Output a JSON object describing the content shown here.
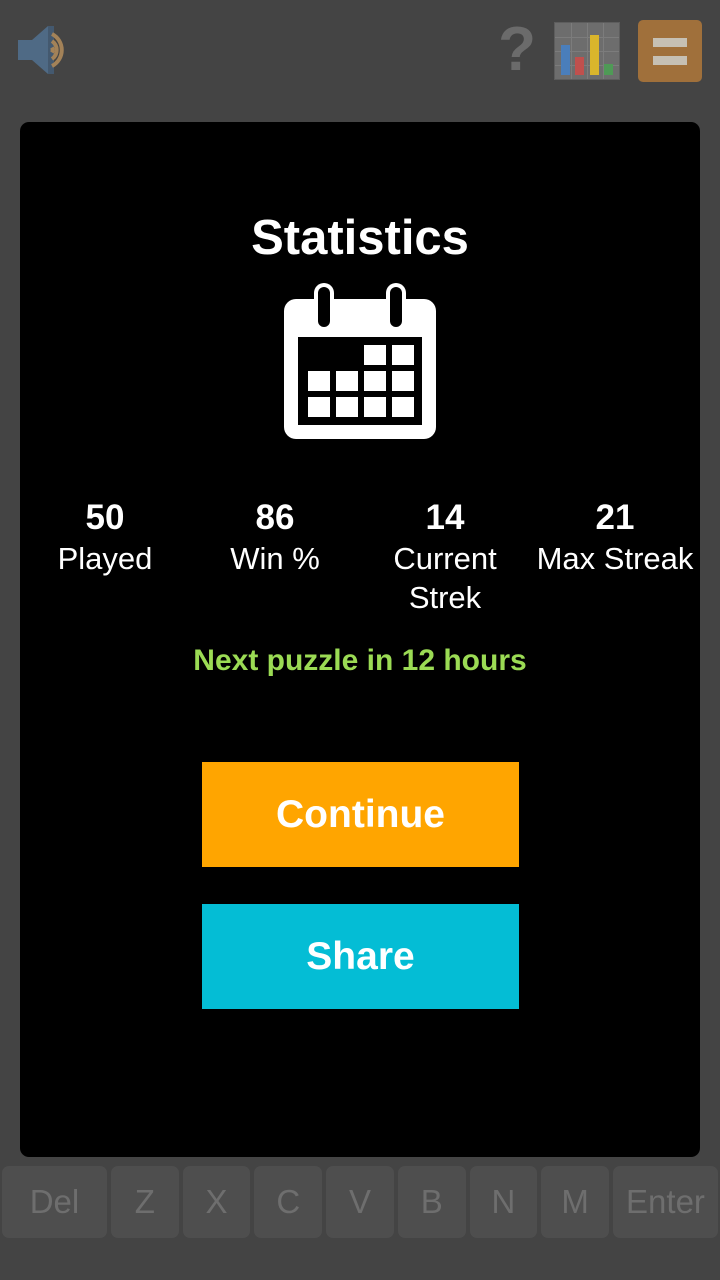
{
  "colors": {
    "app_background": "#444444",
    "modal_background": "#000000",
    "accent_orange": "#ffa500",
    "accent_cyan": "#04bdd5",
    "countdown_green": "#9bdb54",
    "menu_icon_orange": "#a0703b",
    "key_background": "#4e4e4e",
    "key_text": "#6e6e6e"
  },
  "top_bar": {
    "sound_icon": "sound-on-icon",
    "help_icon": "help-question-mark-icon",
    "help_label": "?",
    "chart_icon": "bar-chart-icon",
    "menu_icon": "menu-hamburger-icon"
  },
  "modal": {
    "title": "Statistics",
    "calendar_icon": "calendar-icon",
    "stats": [
      {
        "value": "50",
        "label": "Played"
      },
      {
        "value": "86",
        "label": "Win %"
      },
      {
        "value": "14",
        "label": "Current Strek"
      },
      {
        "value": "21",
        "label": "Max Streak"
      }
    ],
    "countdown": "Next puzzle in 12 hours",
    "continue_label": "Continue",
    "share_label": "Share"
  },
  "keyboard": {
    "keys": [
      {
        "label": "Del",
        "wide": true
      },
      {
        "label": "Z",
        "wide": false
      },
      {
        "label": "X",
        "wide": false
      },
      {
        "label": "C",
        "wide": false
      },
      {
        "label": "V",
        "wide": false
      },
      {
        "label": "B",
        "wide": false
      },
      {
        "label": "N",
        "wide": false
      },
      {
        "label": "M",
        "wide": false
      },
      {
        "label": "Enter",
        "wide": true
      }
    ]
  },
  "chart_icon_bars": [
    {
      "color": "#4a7ebb",
      "height": 30
    },
    {
      "color": "#c0504d",
      "height": 18
    },
    {
      "color": "#d9b52c",
      "height": 40
    },
    {
      "color": "#4f9a56",
      "height": 11
    }
  ]
}
